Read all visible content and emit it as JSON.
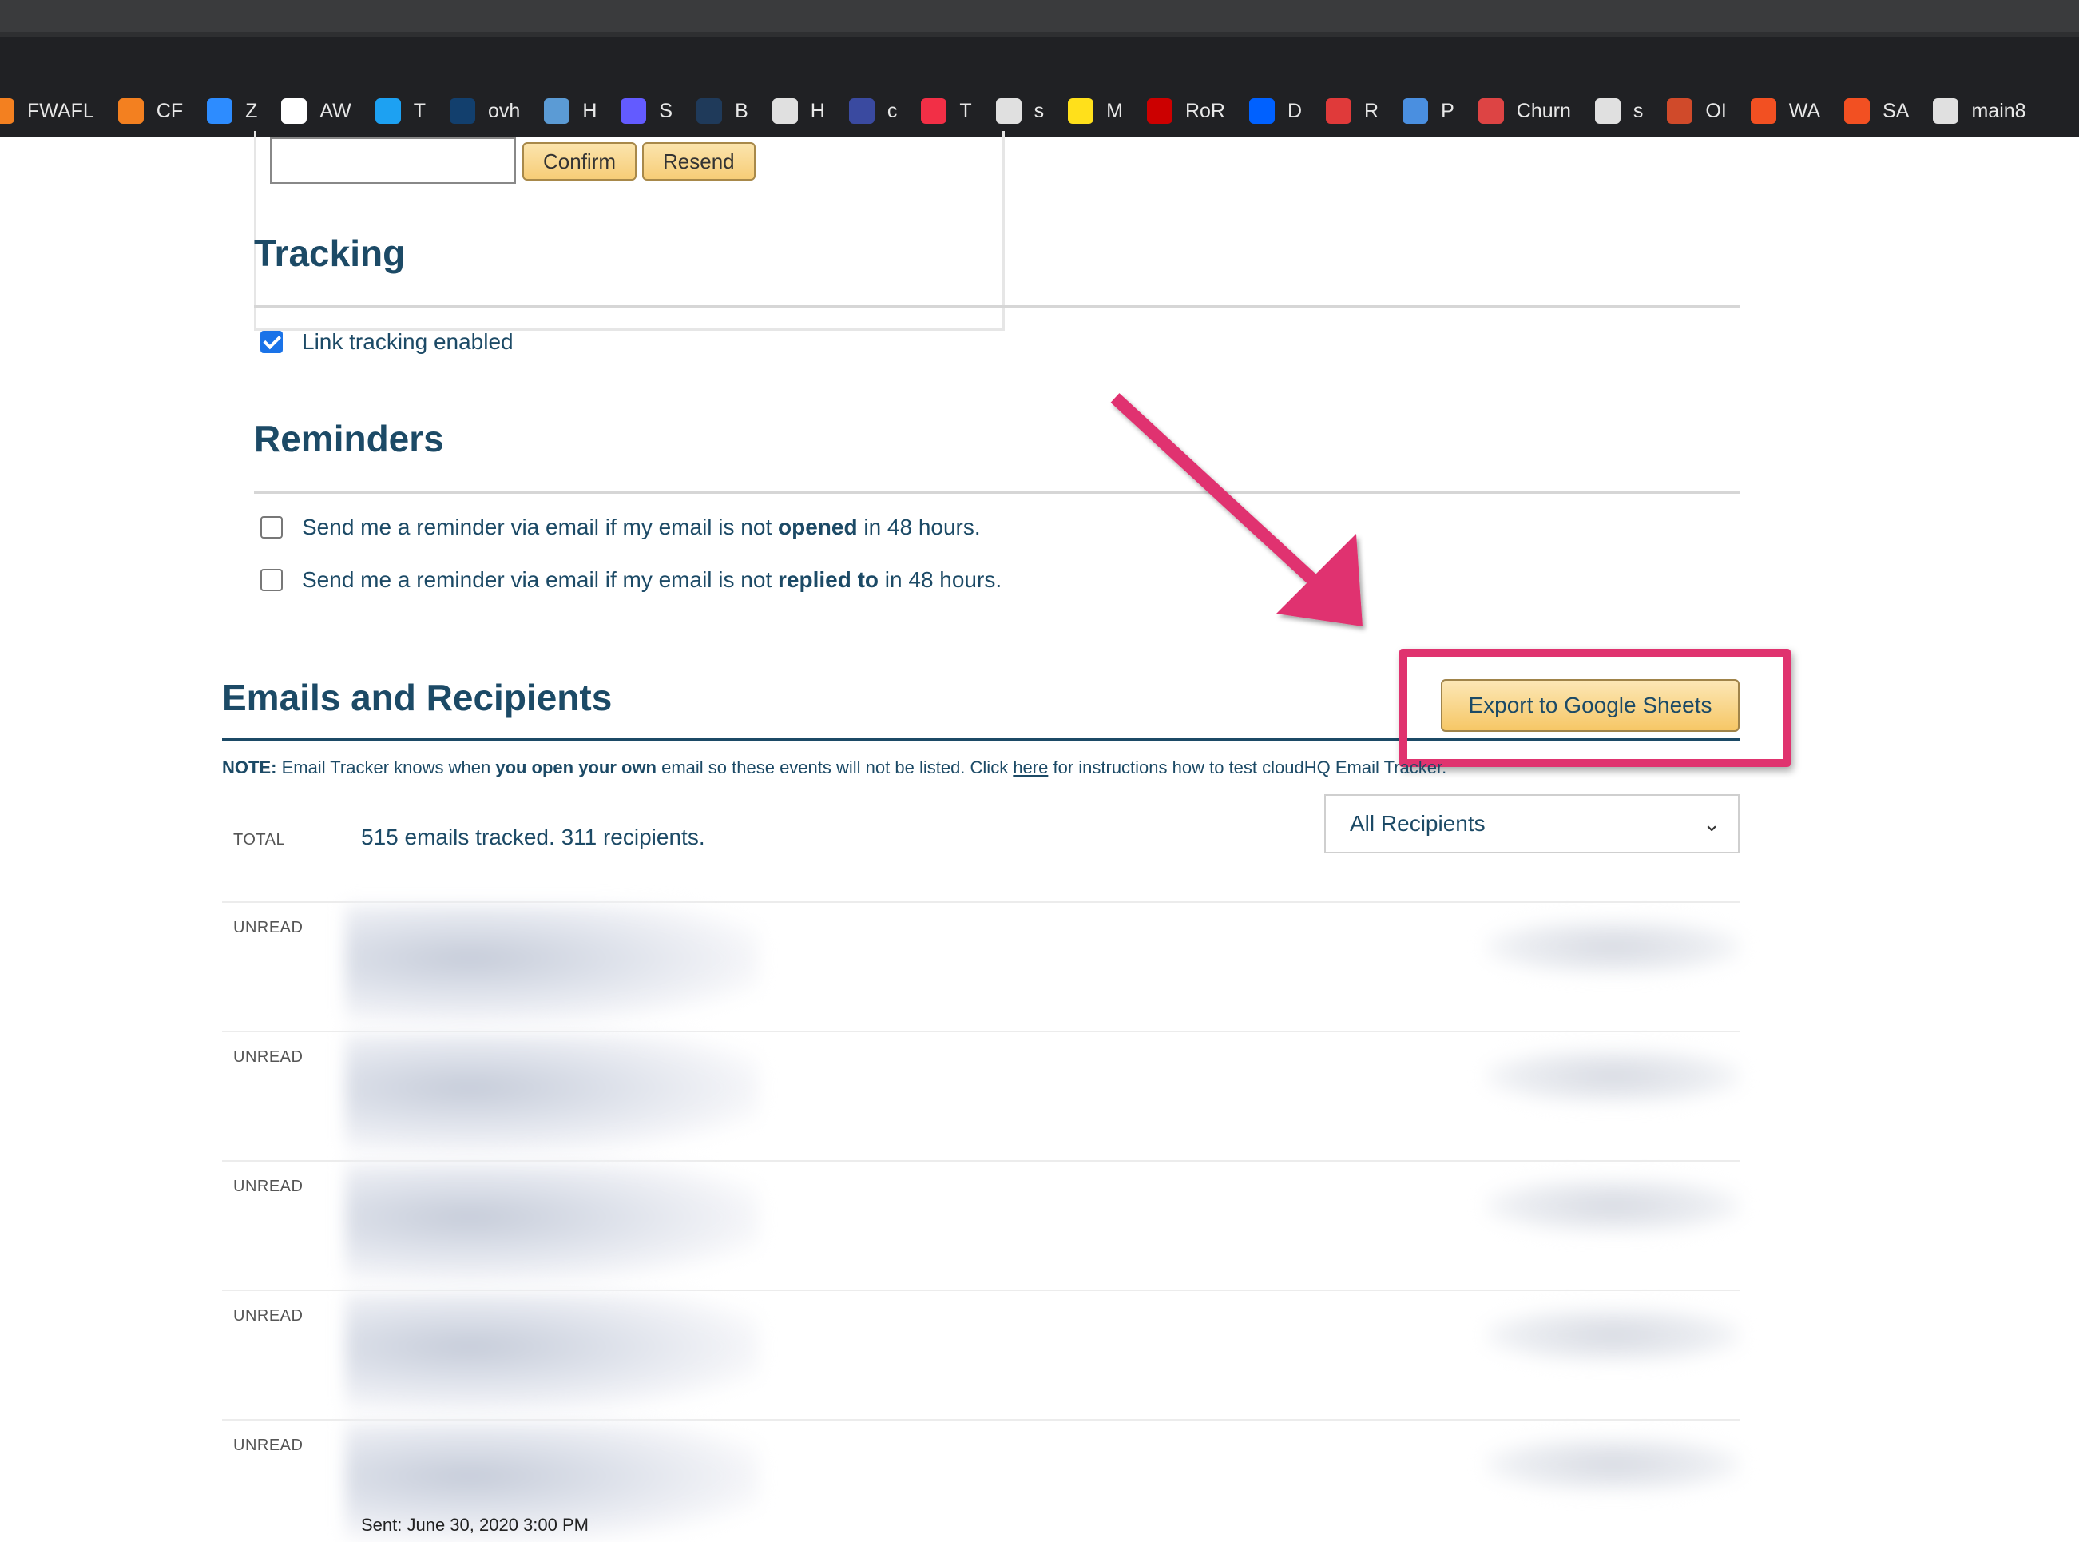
{
  "bookmarks": [
    {
      "label": "FWAFL",
      "icon": "cloud-icon",
      "color": "#f38020"
    },
    {
      "label": "CF",
      "icon": "cloud-icon",
      "color": "#f38020"
    },
    {
      "label": "Z",
      "icon": "video-camera-icon",
      "color": "#2d8cff"
    },
    {
      "label": "AW",
      "icon": "amazon-icon",
      "color": "#ffffff"
    },
    {
      "label": "T",
      "icon": "twitter-bird-icon",
      "color": "#1da1f2"
    },
    {
      "label": "ovh",
      "icon": "ovh-check-icon",
      "color": "#123f6d"
    },
    {
      "label": "H",
      "icon": "house-grid-icon",
      "color": "#5b9bd5"
    },
    {
      "label": "S",
      "icon": "stripe-s-icon",
      "color": "#635bff"
    },
    {
      "label": "B",
      "icon": "bank-icon",
      "color": "#1f3a5a"
    },
    {
      "label": "H",
      "icon": "horse-icon",
      "color": "#e0e0e0"
    },
    {
      "label": "c",
      "icon": "dots-icon",
      "color": "#3a4aa0"
    },
    {
      "label": "T",
      "icon": "twilio-icon",
      "color": "#f22f46"
    },
    {
      "label": "s",
      "icon": "dell-icon",
      "color": "#e0e0e0"
    },
    {
      "label": "M",
      "icon": "mailchimp-icon",
      "color": "#ffe01b"
    },
    {
      "label": "RoR",
      "icon": "ruby-icon",
      "color": "#cc0000"
    },
    {
      "label": "D",
      "icon": "dropbox-icon",
      "color": "#0061ff"
    },
    {
      "label": "R",
      "icon": "red-house-icon",
      "color": "#e03a3a"
    },
    {
      "label": "P",
      "icon": "hand-icon",
      "color": "#4a8fe0"
    },
    {
      "label": "Churn",
      "icon": "mail-icon",
      "color": "#d44"
    },
    {
      "label": "s",
      "icon": "github-icon",
      "color": "#e0e0e0"
    },
    {
      "label": "OI",
      "icon": "chat-icon",
      "color": "#d04a2a"
    },
    {
      "label": "WA",
      "icon": "windows-icon",
      "color": "#f25022"
    },
    {
      "label": "SA",
      "icon": "windows-icon",
      "color": "#f25022"
    },
    {
      "label": "main8",
      "icon": "dell-icon",
      "color": "#e0e0e0"
    }
  ],
  "confirm": {
    "code_placeholder": "",
    "confirm_label": "Confirm",
    "resend_label": "Resend"
  },
  "tracking": {
    "title": "Tracking",
    "link_tracking_label": "Link tracking enabled",
    "link_tracking_checked": true
  },
  "reminders": {
    "title": "Reminders",
    "opened": {
      "prefix": "Send me a reminder via email if my email is not ",
      "bold": "opened",
      "suffix": " in 48 hours."
    },
    "replied": {
      "prefix": "Send me a reminder via email if my email is not ",
      "bold": "replied to",
      "suffix": " in 48 hours."
    }
  },
  "emails": {
    "title": "Emails and Recipients",
    "export_label": "Export to Google Sheets",
    "note": {
      "label": "NOTE:",
      "t1": " Email Tracker knows when ",
      "bold": "you open your own",
      "t2": " email so these events will not be listed. Click ",
      "link": "here",
      "t3": " for instructions how to test cloudHQ Email Tracker."
    },
    "total_label": "TOTAL",
    "total_text": "515 emails tracked. 311 recipients.",
    "filter_selected": "All Recipients",
    "rows": [
      "UNREAD",
      "UNREAD",
      "UNREAD",
      "UNREAD",
      "UNREAD"
    ],
    "bottom_partial": "Sent: June 30, 2020 3:00 PM"
  },
  "annotation": {
    "color": "#e0336f"
  }
}
